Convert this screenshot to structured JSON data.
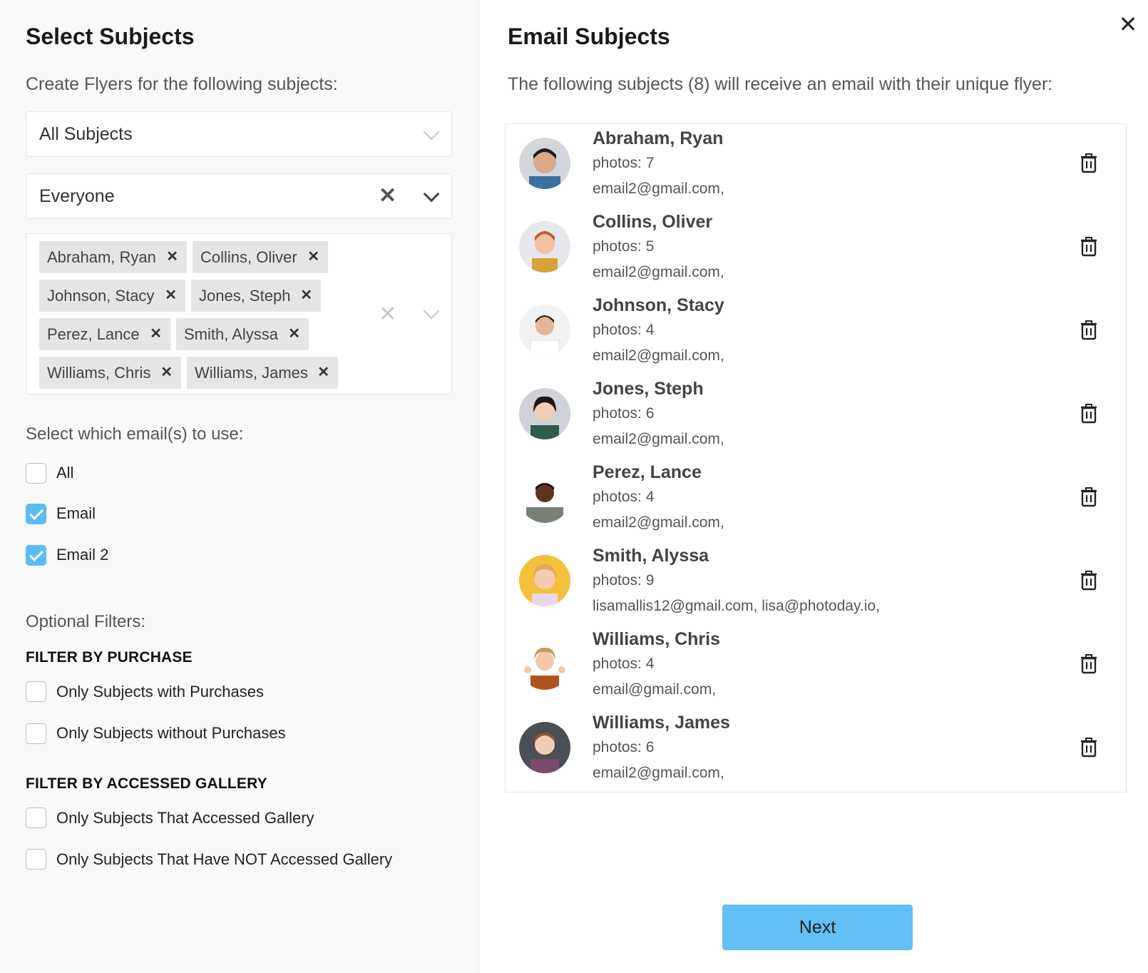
{
  "left": {
    "title": "Select Subjects",
    "subtitle": "Create Flyers for the following subjects:",
    "subjects_select": {
      "value": "All Subjects"
    },
    "group_select": {
      "value": "Everyone"
    },
    "selected_tags": [
      "Abraham, Ryan",
      "Collins, Oliver",
      "Johnson, Stacy",
      "Jones, Steph",
      "Perez, Lance",
      "Smith, Alyssa",
      "Williams, Chris",
      "Williams, James"
    ],
    "email_section_label": "Select which email(s) to use:",
    "email_options": [
      {
        "label": "All",
        "checked": false
      },
      {
        "label": "Email",
        "checked": true
      },
      {
        "label": "Email 2",
        "checked": true
      }
    ],
    "optional_filters_label": "Optional Filters:",
    "purchase_heading": "FILTER BY PURCHASE",
    "purchase_options": [
      {
        "label": "Only Subjects with Purchases",
        "checked": false
      },
      {
        "label": "Only Subjects without Purchases",
        "checked": false
      }
    ],
    "gallery_heading": "FILTER BY ACCESSED GALLERY",
    "gallery_options": [
      {
        "label": "Only Subjects That Accessed Gallery",
        "checked": false
      },
      {
        "label": "Only Subjects That Have NOT Accessed Gallery",
        "checked": false
      }
    ]
  },
  "right": {
    "title": "Email Subjects",
    "subtitle": "The following subjects (8) will receive an email with their unique flyer:",
    "close_icon": "close-icon",
    "subjects": [
      {
        "name": "Abraham, Ryan",
        "photos": "photos: 7",
        "emails": "email2@gmail.com,"
      },
      {
        "name": "Collins, Oliver",
        "photos": "photos: 5",
        "emails": "email2@gmail.com,"
      },
      {
        "name": "Johnson, Stacy",
        "photos": "photos: 4",
        "emails": "email2@gmail.com,"
      },
      {
        "name": "Jones, Steph",
        "photos": "photos: 6",
        "emails": "email2@gmail.com,"
      },
      {
        "name": "Perez, Lance",
        "photos": "photos: 4",
        "emails": "email2@gmail.com,"
      },
      {
        "name": "Smith, Alyssa",
        "photos": "photos: 9",
        "emails": "lisamallis12@gmail.com, lisa@photoday.io,"
      },
      {
        "name": "Williams, Chris",
        "photos": "photos: 4",
        "emails": "email@gmail.com,"
      },
      {
        "name": "Williams, James",
        "photos": "photos: 6",
        "emails": "email2@gmail.com,"
      }
    ],
    "next_label": "Next"
  },
  "colors": {
    "accent": "#5bbcf4",
    "next_button": "#63bff6",
    "tag_bg": "#e5e5e5",
    "left_panel_bg": "#f8f9fa"
  }
}
